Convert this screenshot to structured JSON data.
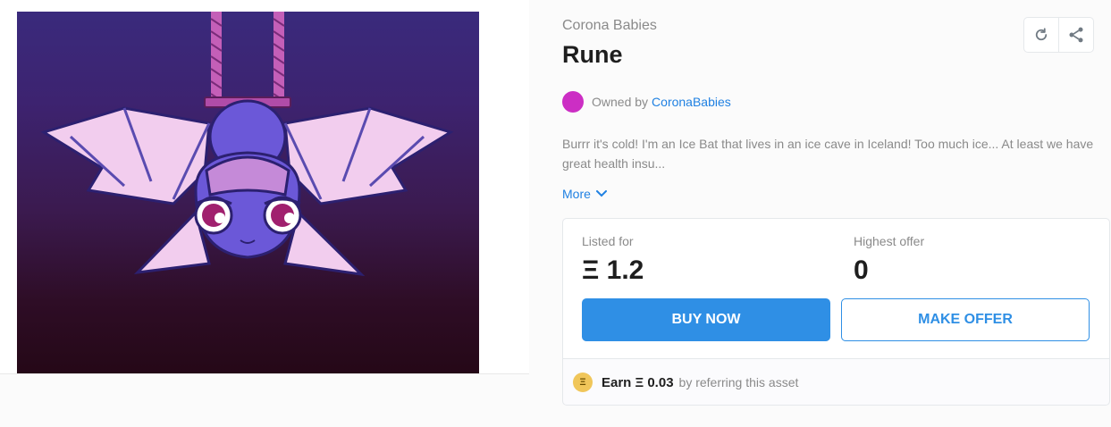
{
  "asset": {
    "collection": "Corona Babies",
    "title": "Rune",
    "owner_prefix": "Owned by",
    "owner_name": "CoronaBabies",
    "description": "Burrr it's cold! I'm an Ice Bat that lives in an ice cave in Iceland! Too much ice... At least we have great health insu...",
    "more_label": "More"
  },
  "actions": {
    "refresh_icon": "refresh-icon",
    "share_icon": "share-icon"
  },
  "price": {
    "listed_label": "Listed for",
    "listed_value": "Ξ 1.2",
    "highest_label": "Highest offer",
    "highest_value": "0",
    "buy_label": "BUY NOW",
    "offer_label": "MAKE OFFER"
  },
  "referral": {
    "coin_symbol": "Ξ",
    "earn_label": "Earn Ξ 0.03",
    "suffix": "by referring this asset"
  },
  "colors": {
    "accent": "#2081e2",
    "button": "#2f8fe5",
    "avatar": "#cc2ec4"
  }
}
